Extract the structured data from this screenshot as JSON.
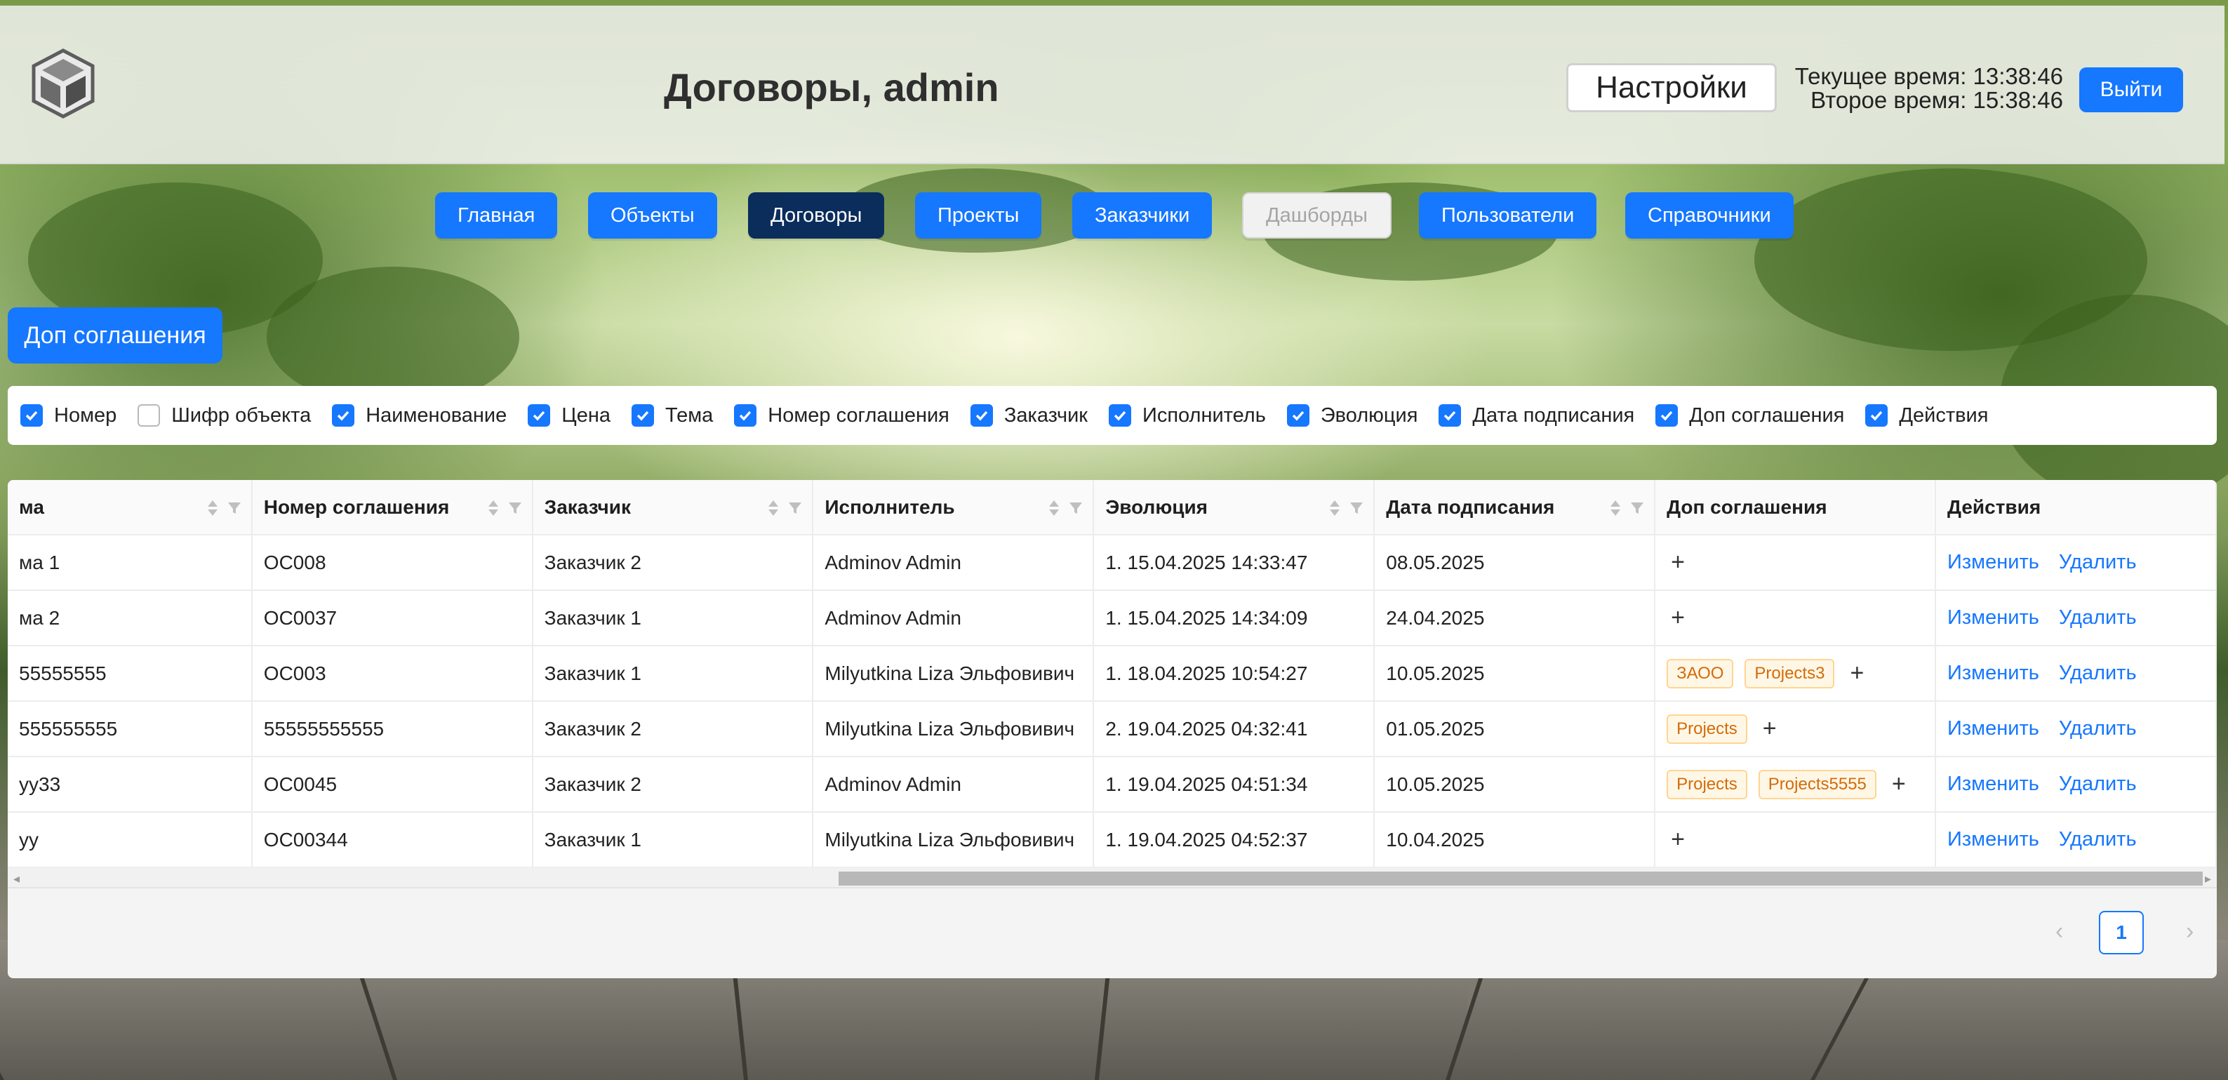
{
  "header": {
    "title": "Договоры, admin",
    "settings_label": "Настройки",
    "current_time": "Текущее время: 13:38:46",
    "second_time": "Второе время: 15:38:46",
    "logout_label": "Выйти"
  },
  "nav": {
    "items": [
      {
        "label": "Главная",
        "state": "default"
      },
      {
        "label": "Объекты",
        "state": "default"
      },
      {
        "label": "Договоры",
        "state": "active"
      },
      {
        "label": "Проекты",
        "state": "default"
      },
      {
        "label": "Заказчики",
        "state": "default"
      },
      {
        "label": "Дашборды",
        "state": "disabled"
      },
      {
        "label": "Пользователи",
        "state": "default"
      },
      {
        "label": "Справочники",
        "state": "default"
      }
    ]
  },
  "extra_button_label": "Доп соглашения",
  "column_toggles": [
    {
      "label": "Номер",
      "checked": true
    },
    {
      "label": "Шифр объекта",
      "checked": false
    },
    {
      "label": "Наименование",
      "checked": true
    },
    {
      "label": "Цена",
      "checked": true
    },
    {
      "label": "Тема",
      "checked": true
    },
    {
      "label": "Номер соглашения",
      "checked": true
    },
    {
      "label": "Заказчик",
      "checked": true
    },
    {
      "label": "Исполнитель",
      "checked": true
    },
    {
      "label": "Эволюция",
      "checked": true
    },
    {
      "label": "Дата подписания",
      "checked": true
    },
    {
      "label": "Доп соглашения",
      "checked": true
    },
    {
      "label": "Действия",
      "checked": true
    }
  ],
  "table": {
    "columns": [
      "ма",
      "Номер соглашения",
      "Заказчик",
      "Исполнитель",
      "Эволюция",
      "Дата подписания",
      "Доп соглашения",
      "Действия"
    ],
    "edit_label": "Изменить",
    "delete_label": "Удалить",
    "add_symbol": "+",
    "rows": [
      {
        "theme": "ма 1",
        "number": "ОС008",
        "customer": "Заказчик 2",
        "executor": "Adminov Admin",
        "evolution": "1. 15.04.2025 14:33:47",
        "date": "08.05.2025",
        "tags": []
      },
      {
        "theme": "ма 2",
        "number": "ОС0037",
        "customer": "Заказчик 1",
        "executor": "Adminov Admin",
        "evolution": "1. 15.04.2025 14:34:09",
        "date": "24.04.2025",
        "tags": []
      },
      {
        "theme": "55555555",
        "number": "ОС003",
        "customer": "Заказчик 1",
        "executor": "Milyutkina Liza Эльфовивич",
        "evolution": "1. 18.04.2025 10:54:27",
        "date": "10.05.2025",
        "tags": [
          "ЗАОО",
          "Projects3"
        ]
      },
      {
        "theme": "555555555",
        "number": "55555555555",
        "customer": "Заказчик 2",
        "executor": "Milyutkina Liza Эльфовивич",
        "evolution": "2. 19.04.2025 04:32:41",
        "date": "01.05.2025",
        "tags": [
          "Projects"
        ]
      },
      {
        "theme": "yy33",
        "number": "ОС0045",
        "customer": "Заказчик 2",
        "executor": "Adminov Admin",
        "evolution": "1. 19.04.2025 04:51:34",
        "date": "10.05.2025",
        "tags": [
          "Projects",
          "Projects5555"
        ]
      },
      {
        "theme": "yy",
        "number": "ОС00344",
        "customer": "Заказчик 1",
        "executor": "Milyutkina Liza Эльфовивич",
        "evolution": "1. 19.04.2025 04:52:37",
        "date": "10.04.2025",
        "tags": []
      }
    ]
  },
  "pagination": {
    "current_page": "1",
    "prev_symbol": "‹",
    "next_symbol": "›"
  },
  "colors": {
    "primary": "#1677ff",
    "active_nav": "#0b2d5c",
    "tag_text": "#d46b08",
    "tag_bg": "#fff7e6"
  }
}
